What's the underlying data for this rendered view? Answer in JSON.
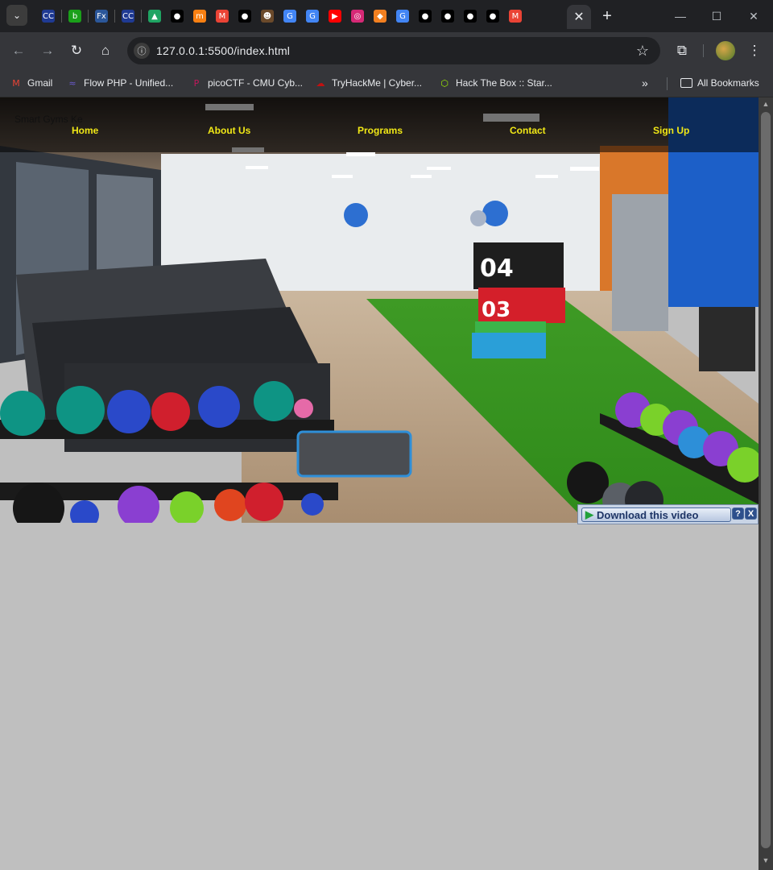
{
  "browser": {
    "tabs": [
      {
        "icon": "codecademy-icon",
        "glyph": "CC",
        "color": "#1f3a93"
      },
      {
        "icon": "bitdefender-icon",
        "glyph": "b",
        "color": "#1aa01a"
      },
      {
        "icon": "formula-icon",
        "glyph": "Fx",
        "color": "#2b579a"
      },
      {
        "icon": "codecademy-icon",
        "glyph": "CC",
        "color": "#1f3a93"
      },
      {
        "icon": "google-drive-icon",
        "glyph": "▲",
        "color": "#1fa463"
      },
      {
        "icon": "github-icon",
        "glyph": "●",
        "color": "#000"
      },
      {
        "icon": "moodle-icon",
        "glyph": "m",
        "color": "#f98012"
      },
      {
        "icon": "gmail-icon",
        "glyph": "M",
        "color": "#ea4335"
      },
      {
        "icon": "github-icon",
        "glyph": "●",
        "color": "#000"
      },
      {
        "icon": "hacker-icon",
        "glyph": "☻",
        "color": "#6b4a2b"
      },
      {
        "icon": "google-icon",
        "glyph": "G",
        "color": "#4285f4"
      },
      {
        "icon": "google-icon",
        "glyph": "G",
        "color": "#4285f4"
      },
      {
        "icon": "youtube-icon",
        "glyph": "▶",
        "color": "#ff0000"
      },
      {
        "icon": "instagram-icon",
        "glyph": "◎",
        "color": "#d62976"
      },
      {
        "icon": "cloud-icon",
        "glyph": "◆",
        "color": "#f38020"
      },
      {
        "icon": "google-icon",
        "glyph": "G",
        "color": "#4285f4"
      },
      {
        "icon": "github-icon",
        "glyph": "●",
        "color": "#000"
      },
      {
        "icon": "github-icon",
        "glyph": "●",
        "color": "#000"
      },
      {
        "icon": "github-icon",
        "glyph": "●",
        "color": "#000"
      },
      {
        "icon": "github-icon",
        "glyph": "●",
        "color": "#000"
      },
      {
        "icon": "gmail-icon",
        "glyph": "M",
        "color": "#ea4335"
      }
    ],
    "active_tab_close": "✕",
    "new_tab": "+",
    "url": "127.0.0.1:5500/index.html",
    "bookmarks": [
      {
        "label": "Gmail",
        "icon": "gmail-icon",
        "glyph": "M",
        "color": "#ea4335"
      },
      {
        "label": "Flow PHP - Unified...",
        "icon": "flow-php-icon",
        "glyph": "≈",
        "color": "#6a5acd"
      },
      {
        "label": "picoCTF - CMU Cyb...",
        "icon": "picoctf-icon",
        "glyph": "P",
        "color": "#c2185b"
      },
      {
        "label": "TryHackMe | Cyber...",
        "icon": "tryhackme-icon",
        "glyph": "☁",
        "color": "#c11111"
      },
      {
        "label": "Hack The Box :: Star...",
        "icon": "hackthebox-icon",
        "glyph": "⬡",
        "color": "#9fef00"
      }
    ],
    "all_bookmarks": "All Bookmarks"
  },
  "site": {
    "brand": "Smart Gyms Ke",
    "nav": [
      "Home",
      "About Us",
      "Programs",
      "Contact",
      "Sign Up"
    ],
    "nav_color": "#f1e816"
  },
  "download_bar": {
    "label": "Download this video",
    "help": "?",
    "close": "X"
  }
}
